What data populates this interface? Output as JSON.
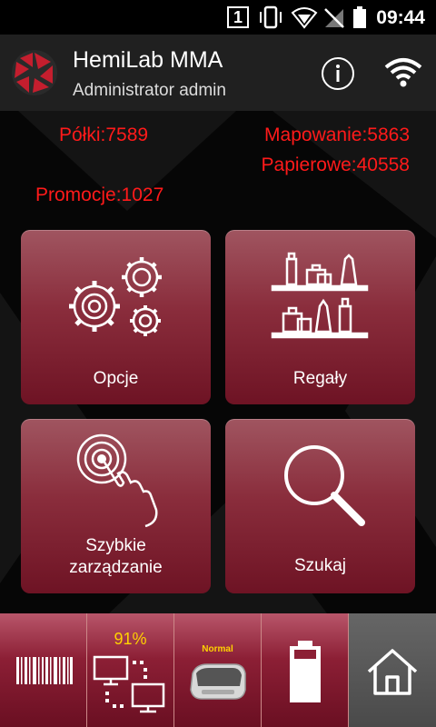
{
  "status_bar": {
    "sim_number": "1",
    "time": "09:44",
    "icons": [
      "vibrate-icon",
      "wifi-signal-icon",
      "no-signal-icon",
      "battery-icon"
    ]
  },
  "header": {
    "title": "HemiLab MMA",
    "subtitle": "Administrator admin",
    "logo_icon": "aperture-logo-icon",
    "info_icon": "info-icon",
    "wifi_icon": "wifi-icon"
  },
  "stats": {
    "polki": "Półki:7589",
    "mapowanie": "Mapowanie:5863",
    "papierowe": "Papierowe:40558",
    "promocje": "Promocje:1027"
  },
  "tiles": [
    {
      "label": "Opcje",
      "icon": "gears-icon"
    },
    {
      "label": "Regały",
      "icon": "shelves-icon"
    },
    {
      "label_line1": "Szybkie",
      "label_line2": "zarządzanie",
      "icon": "touch-hand-icon"
    },
    {
      "label": "Szukaj",
      "icon": "magnifier-icon"
    }
  ],
  "bottom_bar": {
    "barcode_icon": "barcode-icon",
    "sync_percent": "91%",
    "printer_status": "Normal",
    "battery_icon": "battery-icon",
    "home_icon": "home-icon"
  },
  "colors": {
    "stat_text": "#ff1a1a",
    "tile_top": "#a05560",
    "tile_bottom": "#6e1324",
    "accent_yellow": "#ffd200"
  }
}
